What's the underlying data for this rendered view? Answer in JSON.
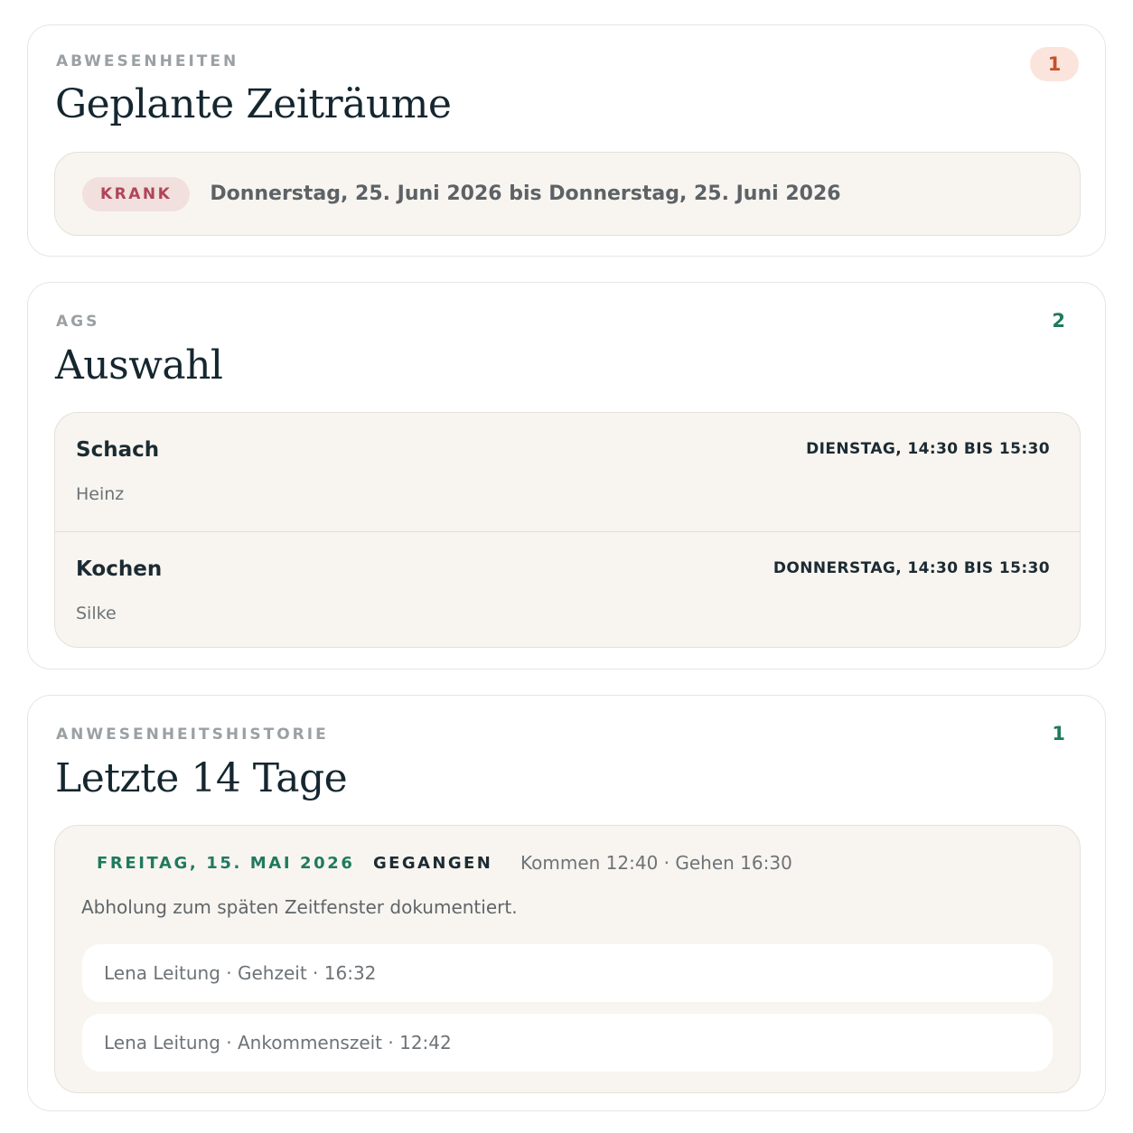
{
  "absences": {
    "eyebrow": "ABWESENHEITEN",
    "title": "Geplante Zeiträume",
    "count": "1",
    "items": [
      {
        "tag": "KRANK",
        "range": "Donnerstag, 25. Juni 2026 bis Donnerstag, 25. Juni 2026"
      }
    ]
  },
  "ags": {
    "eyebrow": "AGS",
    "title": "Auswahl",
    "count": "2",
    "items": [
      {
        "name": "Schach",
        "leader": "Heinz",
        "time": "DIENSTAG, 14:30 BIS 15:30"
      },
      {
        "name": "Kochen",
        "leader": "Silke",
        "time": "DONNERSTAG, 14:30 BIS 15:30"
      }
    ]
  },
  "history": {
    "eyebrow": "ANWESENHEITSHISTORIE",
    "title": "Letzte 14 Tage",
    "count": "1",
    "entries": [
      {
        "date": "FREITAG, 15. MAI 2026",
        "status": "GEGANGEN",
        "times": "Kommen 12:40 · Gehen 16:30",
        "note": "Abholung zum späten Zeitfenster dokumentiert.",
        "log": [
          "Lena Leitung · Gehzeit · 16:32",
          "Lena Leitung · Ankommenszeit · 12:42"
        ]
      }
    ]
  },
  "colors": {
    "accent_green": "#1f7a5e",
    "badge_orange": "#c4502e",
    "badge_orange_bg": "#fbe4dc",
    "tag_krank": "#b0455a",
    "tag_krank_bg": "#f1e0de",
    "panel_bg": "#f8f5f0"
  }
}
